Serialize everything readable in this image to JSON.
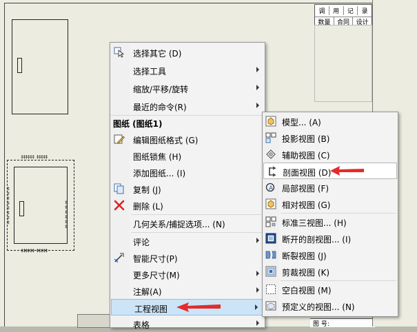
{
  "drawing": {
    "titleblock_row1": [
      "调",
      "用",
      "记",
      "录"
    ],
    "titleblock_row2": [
      "数量",
      "合同号",
      "设计"
    ],
    "bottom_label": "图 号:"
  },
  "context_menu": {
    "items": [
      {
        "label": "选择其它 (D)",
        "icon": "select-other-icon"
      },
      {
        "label": "选择工具",
        "submenu": true
      },
      {
        "label": "缩放/平移/旋转",
        "submenu": true
      },
      {
        "label": "最近的命令(R)",
        "submenu": true
      },
      {
        "label": "图纸 (图纸1)",
        "header": true
      },
      {
        "label": "编辑图纸格式 (G)",
        "icon": "edit-sheet-format-icon"
      },
      {
        "label": "图纸锁焦 (H)"
      },
      {
        "label": "添加图纸... (I)"
      },
      {
        "label": "复制 (J)",
        "icon": "copy-icon"
      },
      {
        "label": "删除 (L)",
        "icon": "delete-icon"
      },
      {
        "label": "几何关系/捕捉选项... (N)"
      },
      {
        "label": "评论",
        "submenu": true
      },
      {
        "label": "智能尺寸(P)",
        "icon": "smart-dimension-icon"
      },
      {
        "label": "更多尺寸(M)",
        "submenu": true
      },
      {
        "label": "注解(A)",
        "submenu": true
      },
      {
        "label": "工程视图",
        "submenu": true,
        "highlighted": true
      },
      {
        "label": "表格",
        "submenu": true
      }
    ]
  },
  "submenu": {
    "items": [
      {
        "label": "模型... (A)",
        "icon": "model-view-icon"
      },
      {
        "label": "投影视图 (B)",
        "icon": "projected-view-icon"
      },
      {
        "label": "辅助视图 (C)",
        "icon": "auxiliary-view-icon"
      },
      {
        "label": "剖面视图 (D)",
        "icon": "section-view-icon",
        "highlighted": true
      },
      {
        "label": "局部视图 (F)",
        "icon": "detail-view-icon"
      },
      {
        "label": "相对视图 (G)",
        "icon": "relative-view-icon"
      },
      {
        "label": "标准三视图... (H)",
        "icon": "standard-3-view-icon"
      },
      {
        "label": "断开的剖视图... (I)",
        "icon": "broken-out-section-icon"
      },
      {
        "label": "断裂视图 (J)",
        "icon": "break-view-icon"
      },
      {
        "label": "剪裁视图 (K)",
        "icon": "crop-view-icon"
      },
      {
        "label": "空白视图 (M)",
        "icon": "empty-view-icon"
      },
      {
        "label": "预定义的视图... (N)",
        "icon": "predefined-view-icon"
      }
    ]
  },
  "colors": {
    "arrow": "#e32b2b",
    "highlight": "#cce4f7"
  }
}
